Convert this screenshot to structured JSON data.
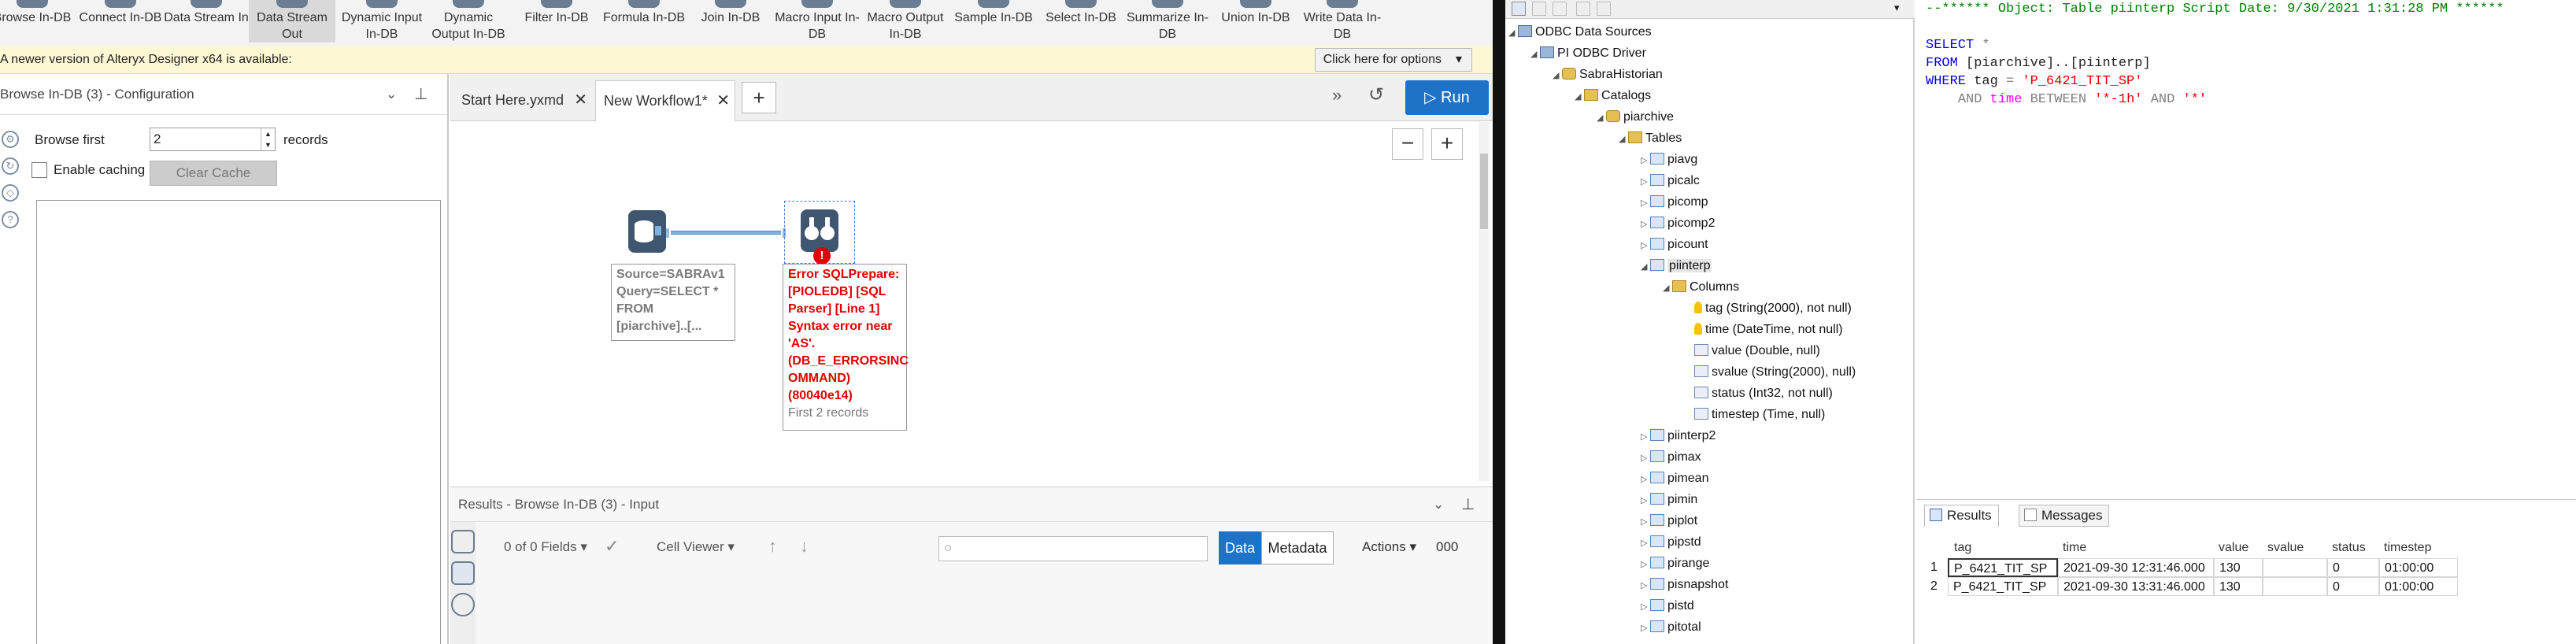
{
  "ribbon": {
    "tools": [
      "Browse In-DB",
      "Connect In-DB",
      "Data Stream In",
      "Data Stream Out",
      "Dynamic Input In-DB",
      "Dynamic Output In-DB",
      "Filter In-DB",
      "Formula In-DB",
      "Join In-DB",
      "Macro Input In-DB",
      "Macro Output In-DB",
      "Sample In-DB",
      "Select In-DB",
      "Summarize In-DB",
      "Union In-DB",
      "Write Data In-DB"
    ]
  },
  "notice": {
    "text": "A newer version of Alteryx Designer x64 is available:",
    "button": "Click here for options"
  },
  "config": {
    "title": "Browse In-DB (3) - Configuration",
    "browse_first_label": "Browse first",
    "browse_first_value": "2",
    "records_label": "records",
    "enable_caching_label": "Enable caching",
    "clear_cache_label": "Clear Cache"
  },
  "workflow": {
    "tabs": [
      "Start Here.yxmd",
      "New Workflow1*"
    ],
    "run_label": "Run",
    "source_annotation": [
      "Source=SABRAv1",
      "Query=SELECT *",
      "FROM",
      "[piarchive]..[..."
    ],
    "error_annotation": [
      "Error SQLPrepare:",
      "[PIOLEDB] [SQL",
      "Parser] [Line 1]",
      "Syntax error near",
      "'AS'.",
      "(DB_E_ERRORSINC",
      "OMMAND)",
      "(80040e14)"
    ],
    "error_footer": "First 2 records"
  },
  "results_panel": {
    "title": "Results - Browse In-DB (3) - Input",
    "fields": "0 of 0 Fields",
    "viewer": "Cell Viewer",
    "data_label": "Data",
    "metadata_label": "Metadata",
    "actions_label": "Actions",
    "extra": "000"
  },
  "tree": {
    "root": "ODBC Data Sources",
    "driver": "PI ODBC Driver",
    "server": "SabraHistorian",
    "catalogs": "Catalogs",
    "catalog": "piarchive",
    "tables_label": "Tables",
    "tables_before": [
      "piavg",
      "picalc",
      "picomp",
      "picomp2",
      "picount"
    ],
    "selected_table": "piinterp",
    "columns_label": "Columns",
    "columns": [
      "tag (String(2000), not null)",
      "time (DateTime, not null)",
      "value (Double, null)",
      "svalue (String(2000), null)",
      "status (Int32, not null)",
      "timestep (Time, null)"
    ],
    "tables_after": [
      "piinterp2",
      "pimax",
      "pimean",
      "pimin",
      "piplot",
      "pipstd",
      "pirange",
      "pisnapshot",
      "pistd",
      "pitotal"
    ]
  },
  "sql": {
    "comment": "--****** Object: Table piinterp Script Date: 9/30/2021 1:31:28 PM ******",
    "select": "SELECT",
    "star": "*",
    "from": "FROM",
    "from_target": "[piarchive]..[piinterp]",
    "where": "WHERE",
    "tag_field": "tag",
    "eq": "=",
    "tag_value": "'P_6421_TIT_SP'",
    "and": "AND",
    "time_field": "time",
    "between": "BETWEEN",
    "start": "'*-1h'",
    "end": "'*'"
  },
  "result_grid": {
    "tabs": [
      "Results",
      "Messages"
    ],
    "headers": [
      "tag",
      "time",
      "value",
      "svalue",
      "status",
      "timestep"
    ],
    "rows": [
      {
        "n": "1",
        "tag": "P_6421_TIT_SP",
        "time": "2021-09-30 12:31:46.000",
        "value": "130",
        "svalue": "",
        "status": "0",
        "timestep": "01:00:00"
      },
      {
        "n": "2",
        "tag": "P_6421_TIT_SP",
        "time": "2021-09-30 13:31:46.000",
        "value": "130",
        "svalue": "",
        "status": "0",
        "timestep": "01:00:00"
      }
    ]
  },
  "colors": {
    "run_blue": "#1e73c8",
    "error_red": "#e00000",
    "notice_bg": "#fdf8d4"
  }
}
